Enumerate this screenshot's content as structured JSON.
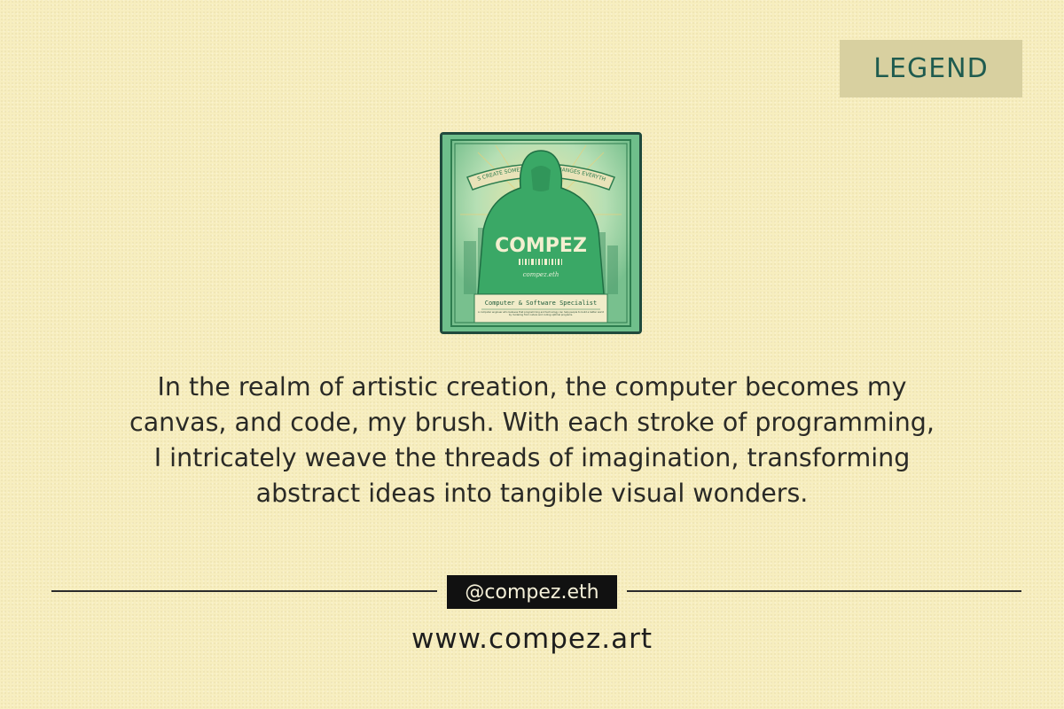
{
  "badge": {
    "label": "LEGEND"
  },
  "poster": {
    "banner": "LET'S CREATE SOMETHING THAT CHANGES EVERYTHING",
    "brand": "COMPEZ",
    "sub_brand": "compez.eth",
    "title": "Computer & Software Specialist",
    "caption": "A computer engineer who believes that programming and technology can help people to build a better world by modeling from nature and coding optimal programs.",
    "colors": {
      "green": "#2f9a5c",
      "hoodie": "#3aa866",
      "frame": "#204a3c",
      "paper": "#f1ecc9"
    }
  },
  "quote": {
    "lines": [
      "In the realm of artistic creation, the computer becomes my",
      "canvas, and code, my brush. With each stroke of programming,",
      "I intricately weave the threads of imagination, transforming",
      "abstract ideas into tangible visual wonders."
    ]
  },
  "footer": {
    "handle": "@compez.eth",
    "website": "www.compez.art"
  },
  "colors": {
    "background": "#f7eebf",
    "badge_bg": "#d8d0a0",
    "badge_text": "#1f5b4f",
    "handle_bg": "#111111"
  }
}
